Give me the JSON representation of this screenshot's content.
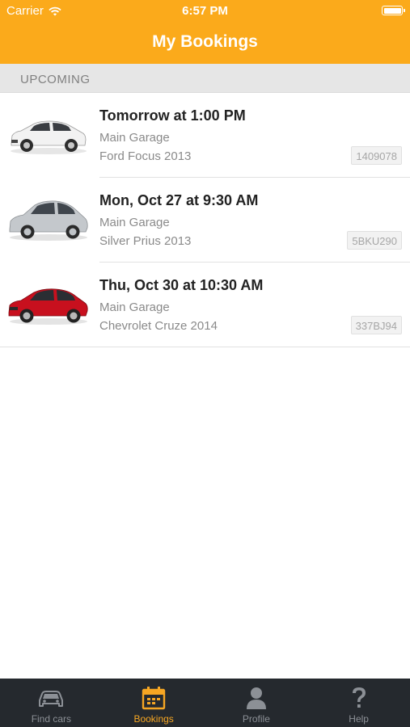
{
  "status_bar": {
    "carrier": "Carrier",
    "time": "6:57 PM"
  },
  "header": {
    "title": "My Bookings"
  },
  "section": {
    "label": "UPCOMING"
  },
  "bookings": [
    {
      "title": "Tomorrow at 1:00 PM",
      "location": "Main Garage",
      "model": "Ford Focus 2013",
      "plate": "1409078",
      "car_color": "#f2f2f2"
    },
    {
      "title": "Mon, Oct 27 at 9:30 AM",
      "location": "Main Garage",
      "model": "Silver Prius 2013",
      "plate": "5BKU290",
      "car_color": "#c4c8cc"
    },
    {
      "title": "Thu, Oct 30 at 10:30 AM",
      "location": "Main Garage",
      "model": "Chevrolet Cruze 2014",
      "plate": "337BJ94",
      "car_color": "#c8101e"
    }
  ],
  "tabs": [
    {
      "label": "Find cars",
      "icon": "car-icon",
      "active": false
    },
    {
      "label": "Bookings",
      "icon": "calendar-icon",
      "active": true
    },
    {
      "label": "Profile",
      "icon": "person-icon",
      "active": false
    },
    {
      "label": "Help",
      "icon": "question-icon",
      "active": false
    }
  ],
  "colors": {
    "accent": "#fbaa1b",
    "tab_active": "#f6a623",
    "tab_bar": "#25292e"
  }
}
